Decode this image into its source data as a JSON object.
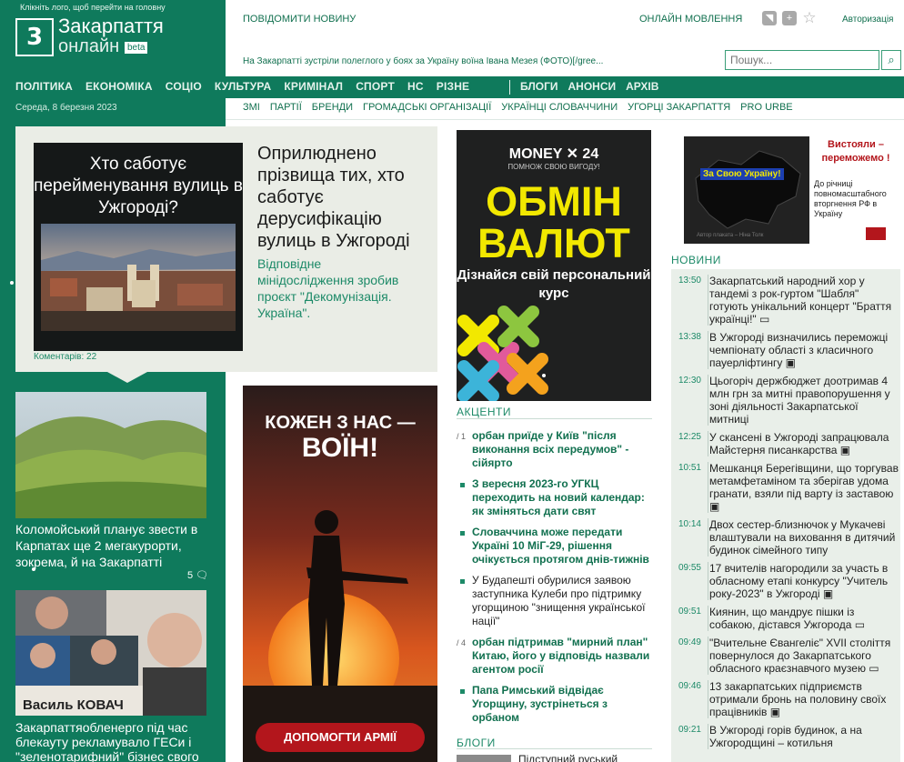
{
  "header": {
    "logo_hint": "Клікніть лого, щоб перейти на головну",
    "logo_line1": "Закарпаття",
    "logo_line2": "онлайн",
    "logo_beta": "beta",
    "logo_mark": "3",
    "report_news": "ПОВІДОМИТИ НОВИНУ",
    "live": "ОНЛАЙН МОВЛЕННЯ",
    "auth": "Авторизація",
    "ticker": "На Закарпатті зустріли полеглого у боях за Україну воїна Івана Мезея (ФОТО)[/gree...",
    "search_placeholder": "Пошук...",
    "date": "Середа, 8 березня 2023"
  },
  "nav_main": [
    "ПОЛІТИКА",
    "ЕКОНОМІКА",
    "СОЦІО",
    "КУЛЬТУРА",
    "КРИМІНАЛ",
    "СПОРТ",
    "НС",
    "РІЗНЕ"
  ],
  "nav_right": [
    "БЛОГИ",
    "АНОНСИ",
    "АРХІВ"
  ],
  "subnav": [
    "ЗМІ",
    "ПАРТІЇ",
    "БРЕНДИ",
    "ГРОМАДСЬКІ ОРГАНІЗАЦІЇ",
    "УКРАЇНЦІ СЛОВАЧЧИНИ",
    "УГОРЦІ ЗАКАРПАТТЯ",
    "PRO URBE"
  ],
  "feature": {
    "image_title": "Хто саботує перейменування вулиць в Ужгороді?",
    "headline": "Оприлюднено прізвища тих, хто саботує дерусифікацію вулиць в Ужгороді",
    "lead": "Відповідне мінідослідження зробив проєкт \"Декомунізація. Україна\".",
    "comments": "Коментарів: 22"
  },
  "left_cards": [
    {
      "title": "Коломойський планує звести в Карпатах ще 2 мегакурорти, зокрема, й на Закарпатті",
      "count": "5"
    },
    {
      "title": "Закарпаттяобленерго під час блекауту рекламувало ГЕСи і \"зеленотарифний\" бізнес свого",
      "image_caption": "Василь КОВАЧ"
    }
  ],
  "ad_army": {
    "line1": "КОЖЕН З НАС —",
    "line2": "ВОЇН!",
    "button": "ДОПОМОГТИ АРМІЇ"
  },
  "ad_money": {
    "logo": "MONEY ✕ 24",
    "tagline": "ПОМНОЖ СВОЮ ВИГОДУ!",
    "big1": "ОБМІН",
    "big2": "ВАЛЮТ",
    "sub": "Дізнайся свій персональний курс"
  },
  "ad_war": {
    "title": "Вистояли – переможемо !",
    "text": "До річниці повномасштабного вторгнення РФ в Україну",
    "slogan": "За Свою Україну!",
    "caption": "Автор плаката – Ніна Толк"
  },
  "accents_title": "АКЦЕНТИ",
  "accents": [
    {
      "mark": "/ 1",
      "text": "орбан приїде у Київ \"після виконання всіх передумов\" - сійярто",
      "bold": true
    },
    {
      "mark": "",
      "text": "З вересня 2023-го УГКЦ переходить на новий календар: як зміняться дати свят",
      "bold": true
    },
    {
      "mark": "",
      "text": "Словаччина може передати Україні 10 МіГ-29, рішення очікується протягом днів-тижнів",
      "bold": true
    },
    {
      "mark": "",
      "text": "У Будапешті обурилися заявою заступника Кулеби про підтримку угорщиною \"знищення української нації\"",
      "bold": false
    },
    {
      "mark": "/ 4",
      "text": "орбан підтримав \"мирний план\" Китаю, його у відповідь назвали агентом росії",
      "bold": true
    },
    {
      "mark": "",
      "text": "Папа Римський відвідає Угорщину, зустрінеться з орбаном",
      "bold": true
    }
  ],
  "blogs_title": "БЛОГИ",
  "blog_item": "Підступний руський",
  "news_title": "НОВИНИ",
  "news": [
    {
      "time": "13:50",
      "text": "Закарпатський народний хор у тандемі з рок-гуртом \"Шабля\" готують унікальний концерт \"Браття українці!\"",
      "icon": "video"
    },
    {
      "time": "13:38",
      "text": "В Ужгороді визначились переможці чемпіонату області з класичного пауерліфтингу",
      "icon": "photo"
    },
    {
      "time": "12:30",
      "text": "Цьогоріч держбюджет доотримав 4 млн грн за митні правопорушення у зоні діяльності Закарпатської митниці",
      "icon": ""
    },
    {
      "time": "12:25",
      "text": "У скансені в Ужгороді запрацювала Майстерня писанкарства",
      "icon": "photo"
    },
    {
      "time": "10:51",
      "text": "Мешканця Берегівщини, що торгував метамфетаміном та зберігав удома гранати, взяли під варту із заставою",
      "icon": "photo"
    },
    {
      "time": "10:14",
      "text": "Двох сестер-близнючок у Мукачеві влаштували на виховання в дитячий будинок сімейного типу",
      "icon": ""
    },
    {
      "time": "09:55",
      "text": "17 вчителів нагородили за участь в обласному етапі конкурсу \"Учитель року-2023\" в Ужгороді",
      "icon": "photo"
    },
    {
      "time": "09:51",
      "text": "Киянин, що мандрує пішки із собакою, дістався Ужгорода",
      "icon": "video"
    },
    {
      "time": "09:49",
      "text": "\"Вчительне Євангеліє\" XVII століття повернулося до Закарпатського обласного краєзнавчого музею",
      "icon": "video"
    },
    {
      "time": "09:46",
      "text": "13 закарпатських підприємств отримали бронь на половину своїх працівників",
      "icon": "photo"
    },
    {
      "time": "09:21",
      "text": "В Ужгороді горів будинок, а на Ужгородщині – котильня",
      "icon": ""
    }
  ],
  "colors": {
    "brand_green": "#0f7a5c",
    "link_green": "#11704f",
    "feature_bg": "#eaede6",
    "news_bg": "#e9efe9"
  }
}
